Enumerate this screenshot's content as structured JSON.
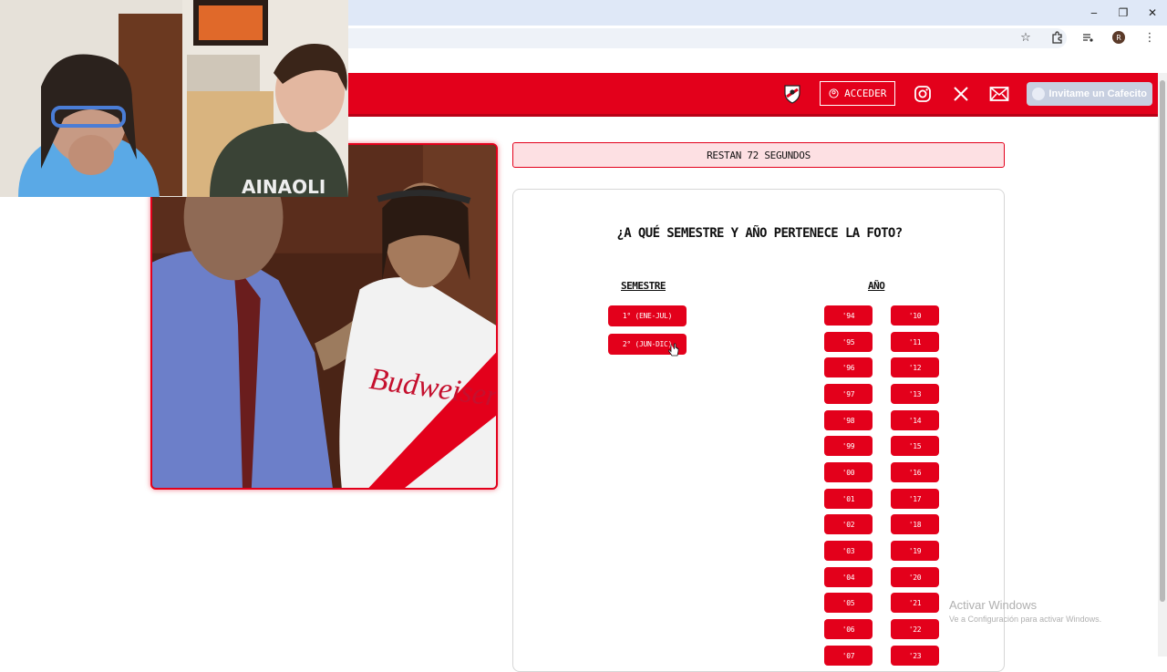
{
  "browser": {
    "win_minimize": "‒",
    "win_restore": "❐",
    "win_close": "✕",
    "profile_initial": "R"
  },
  "header": {
    "login_label": "ACCEDER",
    "coffee_label": "Invitame un Cafecito",
    "icons": [
      "crest-icon",
      "instagram-icon",
      "x-icon",
      "mail-icon"
    ]
  },
  "timer": {
    "text": "RESTAN 72 SEGUNDOS"
  },
  "quiz": {
    "question": "¿A QUÉ SEMESTRE Y AÑO PERTENECE LA FOTO?",
    "semester_title": "SEMESTRE",
    "year_title": "AÑO",
    "semesters": [
      "1° (ENE-JUL)",
      "2° (JUN-DIC)"
    ],
    "years_left": [
      "'94",
      "'95",
      "'96",
      "'97",
      "'98",
      "'99",
      "'00",
      "'01",
      "'02",
      "'03",
      "'04",
      "'05",
      "'06",
      "'07"
    ],
    "years_right": [
      "'10",
      "'11",
      "'12",
      "'13",
      "'14",
      "'15",
      "'16",
      "'17",
      "'18",
      "'19",
      "'20",
      "'21",
      "'22",
      "'23"
    ]
  },
  "watermark": {
    "title": "Activar Windows",
    "subtitle": "Ve a Configuración para activar Windows."
  },
  "colors": {
    "brand": "#e3001b",
    "timer_bg": "#fde0e3"
  }
}
